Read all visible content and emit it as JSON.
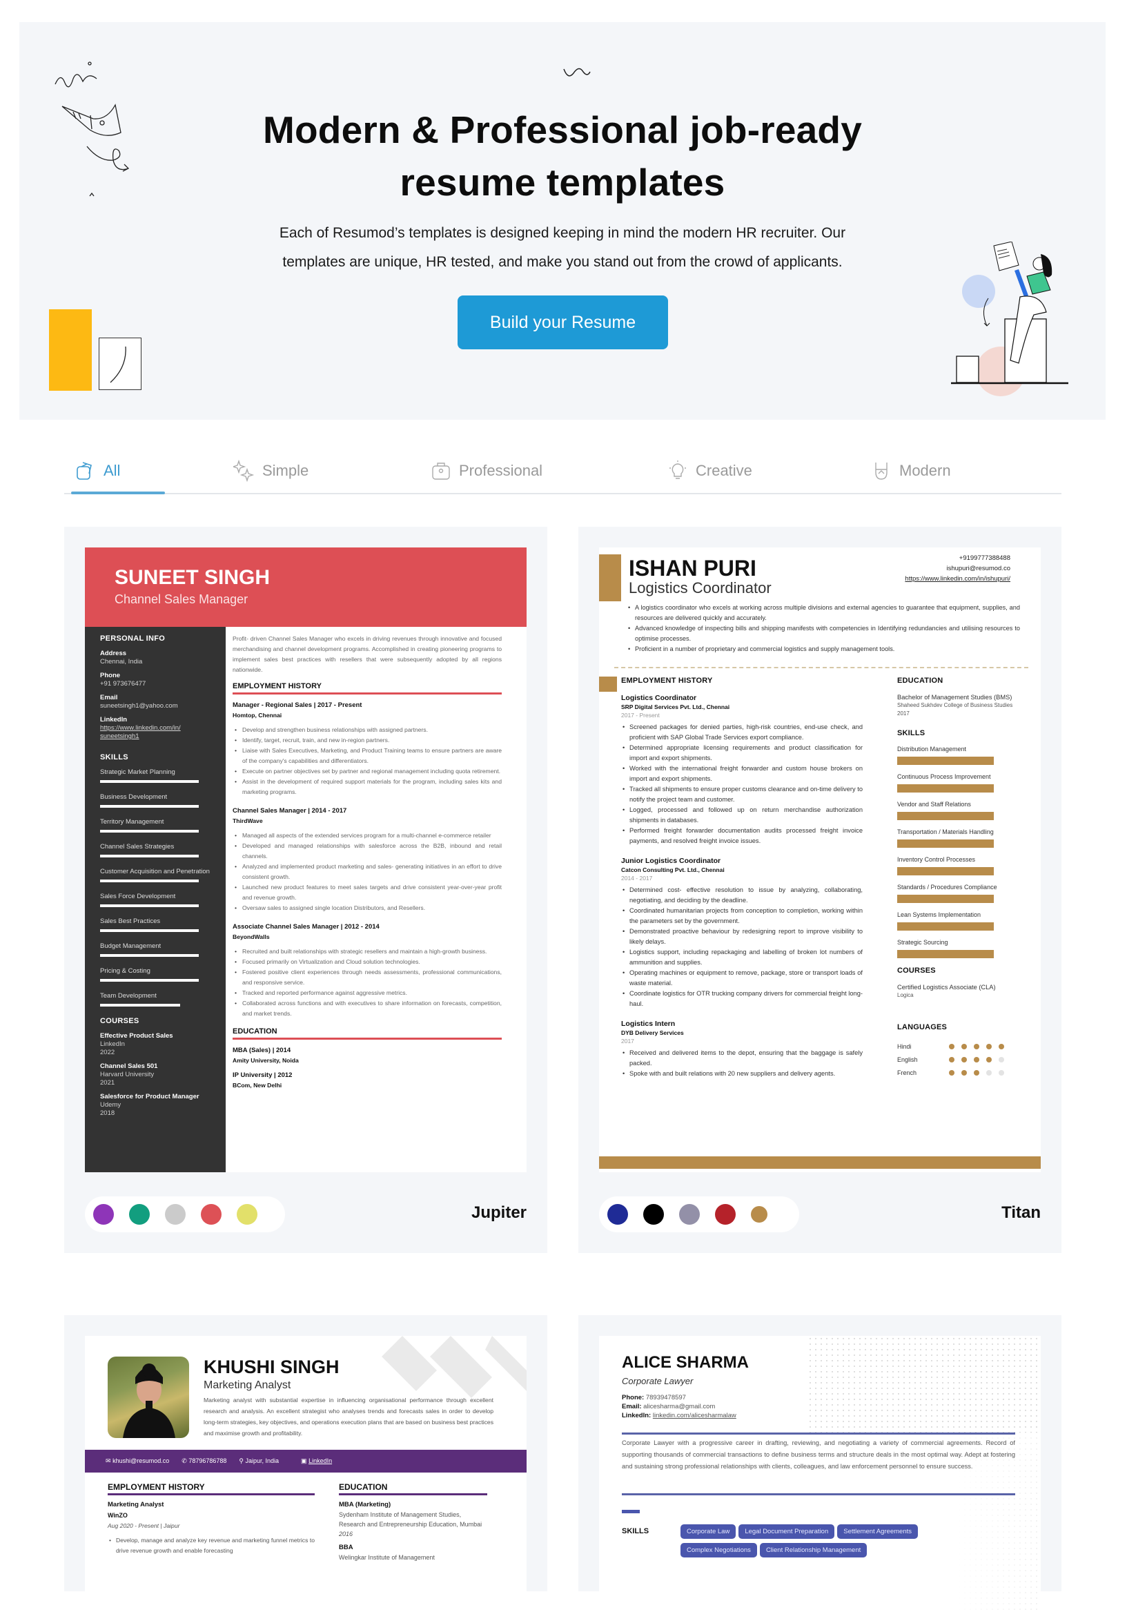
{
  "hero": {
    "title_line1": "Modern & Professional job-ready",
    "title_line2": "resume templates",
    "subtitle_line1": "Each of Resumod’s templates is designed keeping in mind the modern HR recruiter. Our",
    "subtitle_line2": "templates are unique, HR tested, and make you stand out from the crowd of applicants.",
    "cta_label": "Build your Resume",
    "accent": "#1e9ad6"
  },
  "tabs": [
    {
      "label": "All",
      "icon": "layers-icon",
      "active": true
    },
    {
      "label": "Simple",
      "icon": "sparkles-icon",
      "active": false
    },
    {
      "label": "Professional",
      "icon": "briefcase-icon",
      "active": false
    },
    {
      "label": "Creative",
      "icon": "lightbulb-icon",
      "active": false
    },
    {
      "label": "Modern",
      "icon": "rock-hand-icon",
      "active": false
    }
  ],
  "templates": [
    {
      "name": "Jupiter",
      "swatches": [
        "#8e35b8",
        "#129e7f",
        "#cbcbcb",
        "#dd5156",
        "#e2e06a"
      ],
      "resume": {
        "name": "SUNEET SINGH",
        "role": "Channel Sales Manager",
        "personal_info_heading": "PERSONAL INFO",
        "info": [
          {
            "label": "Address",
            "value": "Chennai, India"
          },
          {
            "label": "Phone",
            "value": "+91 973676477"
          },
          {
            "label": "Email",
            "value": "suneetsingh1@yahoo.com"
          },
          {
            "label": "LinkedIn",
            "value": "https://www.linkedin.com/in/ suneetsingh1"
          }
        ],
        "skills_heading": "SKILLS",
        "skills": [
          {
            "name": "Strategic Market Planning",
            "level": 1.0
          },
          {
            "name": "Business Development",
            "level": 1.0
          },
          {
            "name": "Territory Management",
            "level": 1.0
          },
          {
            "name": "Channel Sales Strategies",
            "level": 1.0
          },
          {
            "name": "Customer Acquisition and Penetration",
            "level": 1.0
          },
          {
            "name": "Sales Force Development",
            "level": 1.0
          },
          {
            "name": "Sales Best Practices",
            "level": 1.0
          },
          {
            "name": "Budget Management",
            "level": 1.0
          },
          {
            "name": "Pricing & Costing",
            "level": 1.0
          },
          {
            "name": "Team Development",
            "level": 0.81
          }
        ],
        "courses_heading": "COURSES",
        "courses": [
          {
            "title": "Effective Product Sales",
            "org": "LinkedIn",
            "year": "2022"
          },
          {
            "title": "Channel Sales 501",
            "org": "Harvard University",
            "year": "2021"
          },
          {
            "title": "Salesforce for Product Manager",
            "org": "Udemy",
            "year": "2018"
          }
        ],
        "summary": "Profit- driven Channel Sales Manager who excels in driving revenues through innovative and focused merchandising and channel development programs. Accomplished in creating pioneering programs to implement sales best practices with resellers that were subsequently adopted by all regions nationwide.",
        "employment_heading": "EMPLOYMENT HISTORY",
        "jobs": [
          {
            "title": "Manager - Regional Sales | 2017 - Present",
            "company": "Homtop, Chennai",
            "bullets": [
              "Develop and strengthen business relationships with assigned partners.",
              "Identify, target, recruit, train, and new in-region partners.",
              "Liaise with Sales Executives, Marketing, and Product Training teams to ensure partners are aware of the company's capabilities and differentiators.",
              "Execute on partner objectives set by partner and regional management including quota retirement.",
              "Assist in the development of required support materials for the program, including sales kits and marketing programs."
            ]
          },
          {
            "title": "Channel Sales Manager | 2014 - 2017",
            "company": "ThirdWave",
            "bullets": [
              "Managed all aspects of the extended services program for a multi-channel e-commerce retailer",
              "Developed and managed relationships with salesforce across the B2B, inbound and retail channels.",
              "Analyzed and implemented product marketing and sales- generating initiatives in an effort to drive consistent growth.",
              "Launched new product features to meet sales targets and drive consistent year-over-year profit and revenue growth.",
              "Oversaw sales to assigned single location Distributors, and Resellers."
            ]
          },
          {
            "title": "Associate Channel Sales Manager | 2012 - 2014",
            "company": "BeyondWalls",
            "bullets": [
              "Recruited and built relationships with strategic resellers and maintain a high-growth business.",
              "Focused primarily on Virtualization and Cloud solution technologies.",
              "Fostered positive client experiences through needs assessments, professional communications, and responsive service.",
              "Tracked and reported performance against aggressive metrics.",
              "Collaborated across functions and with executives to share information on forecasts, competition, and market trends."
            ]
          }
        ],
        "education_heading": "EDUCATION",
        "education": [
          {
            "degree": "MBA (Sales) | 2014",
            "school": "Amity University, Noida"
          },
          {
            "degree": "IP University | 2012",
            "school": "BCom, New Delhi"
          }
        ]
      }
    },
    {
      "name": "Titan",
      "swatches": [
        "#1f2b96",
        "#000000",
        "#9390a8",
        "#b5222a",
        "#b88c4a"
      ],
      "resume": {
        "name": "ISHAN PURI",
        "role": "Logistics Coordinator",
        "phone": "+9199777388488",
        "email": "ishupuri@resumod.co",
        "linkedin": "https://www.linkedin.com/in/ishupuri/",
        "summary": [
          "A logistics coordinator who excels at working across multiple divisions and external agencies to guarantee that equipment, supplies, and resources are delivered quickly and accurately.",
          "Advanced knowledge of inspecting bills and shipping manifests with competencies in Identifying redundancies and utilising resources to optimise processes.",
          "Proficient in a number of proprietary and commercial logistics and supply management tools."
        ],
        "employment_heading": "EMPLOYMENT HISTORY",
        "jobs": [
          {
            "title": "Logistics Coordinator",
            "company": "SRP Digital Services Pvt. Ltd., Chennai",
            "years": "2017 - Present",
            "bullets": [
              "Screened packages for denied parties, high-risk countries, end-use check, and proficient with SAP Global Trade Services export compliance.",
              "Determined appropriate licensing requirements and product classification for import and export shipments.",
              "Worked with the international freight forwarder and custom house brokers on import and export shipments.",
              "Tracked all shipments to ensure proper customs clearance and on-time delivery to notify the project team and customer.",
              "Logged, processed and followed up on return merchandise authorization shipments in databases.",
              "Performed freight forwarder documentation audits processed freight invoice payments, and resolved freight invoice issues."
            ]
          },
          {
            "title": "Junior Logistics Coordinator",
            "company": "Catcon Consulting Pvt. Ltd., Chennai",
            "years": "2014 - 2017",
            "bullets": [
              "Determined cost- effective resolution to issue by analyzing, collaborating, negotiating, and deciding by the deadline.",
              "Coordinated humanitarian projects from conception to completion, working within the parameters set by the government.",
              "Demonstrated proactive behaviour by redesigning report to improve visibility to likely delays.",
              "Logistics support, including repackaging and labelling of broken lot numbers of ammunition and supplies.",
              "Operating machines or equipment to remove, package, store or transport loads of waste material.",
              "Coordinate logistics for OTR trucking company drivers for commercial freight long-haul."
            ]
          },
          {
            "title": "Logistics Intern",
            "company": "DYB Delivery Services",
            "years": "2017",
            "bullets": [
              "Received and delivered items to the depot, ensuring that the baggage is safely packed.",
              "Spoke with and built relations with 20 new suppliers and delivery agents."
            ]
          }
        ],
        "education_heading": "EDUCATION",
        "education": {
          "degree": "Bachelor of Management Studies (BMS)",
          "school": "Shaheed Sukhdev College of Business Studies",
          "year": "2017"
        },
        "skills_heading": "SKILLS",
        "skills": [
          {
            "name": "Distribution Management",
            "level": 1.0
          },
          {
            "name": "Continuous Process Improvement",
            "level": 1.0
          },
          {
            "name": "Vendor and Staff Relations",
            "level": 1.0
          },
          {
            "name": "Transportation / Materials Handling",
            "level": 1.0
          },
          {
            "name": "Inventory Control Processes",
            "level": 1.0
          },
          {
            "name": "Standards / Procedures Compliance",
            "level": 1.0
          },
          {
            "name": "Lean Systems Implementation",
            "level": 1.0
          },
          {
            "name": "Strategic Sourcing",
            "level": 1.0
          }
        ],
        "courses_heading": "COURSES",
        "course": {
          "title": "Certified Logistics Associate (CLA)",
          "org": "Logica"
        },
        "languages_heading": "LANGUAGES",
        "languages": [
          {
            "name": "Hindi",
            "rating": 5,
            "max": 5
          },
          {
            "name": "English",
            "rating": 4,
            "max": 5
          },
          {
            "name": "French",
            "rating": 3,
            "max": 5
          }
        ]
      }
    },
    {
      "name": "",
      "resume": {
        "name": "KHUSHI SINGH",
        "role": "Marketing Analyst",
        "summary": "Marketing analyst with substantial expertise in influencing organisational performance through excellent research and analysis. An excellent strategist who analyses trends and forecasts sales in order to develop long-term strategies, key objectives, and operations execution plans that are based on business best practices and maximise growth and profitability.",
        "email": "khushi@resumod.co",
        "phone": "78796786788",
        "location": "Jaipur, India",
        "linkedin": "LinkedIn",
        "employment_heading": "EMPLOYMENT HISTORY",
        "job": {
          "title": "Marketing Analyst",
          "company": "WinZO",
          "dates": "Aug 2020 - Present | Jaipur",
          "bullets": [
            "Develop, manage and analyze key revenue and marketing funnel metrics to drive revenue growth and enable forecasting"
          ]
        },
        "education_heading": "EDUCATION",
        "education": [
          {
            "degree": "MBA (Marketing)",
            "school": "Sydenham Institute of Management Studies, Research and Entrepreneurship Education, Mumbai",
            "year": "2016"
          },
          {
            "degree": "BBA",
            "school": "Welingkar Institute of Management",
            "year": ""
          }
        ]
      }
    },
    {
      "name": "",
      "resume": {
        "name": "ALICE SHARMA",
        "role": "Corporate Lawyer",
        "phone_label": "Phone:",
        "phone": "78939478597",
        "email_label": "Email:",
        "email": "alicesharma@gmail.com",
        "linkedin_label": "LinkedIn:",
        "linkedin": "linkedin.com/alicesharmalaw",
        "summary": "Corporate Lawyer with a progressive career in drafting, reviewing, and negotiating a variety of commercial agreements. Record of supporting thousands of commercial transactions to define business terms and structure deals in the most optimal way. Adept at fostering and sustaining strong professional relationships with clients, colleagues, and law enforcement personnel to ensure success.",
        "skills_heading": "SKILLS",
        "skills": [
          "Corporate Law",
          "Legal Document Preparation",
          "Settlement Agreements",
          "Complex Negotiations",
          "Client Relationship Management"
        ]
      }
    }
  ]
}
